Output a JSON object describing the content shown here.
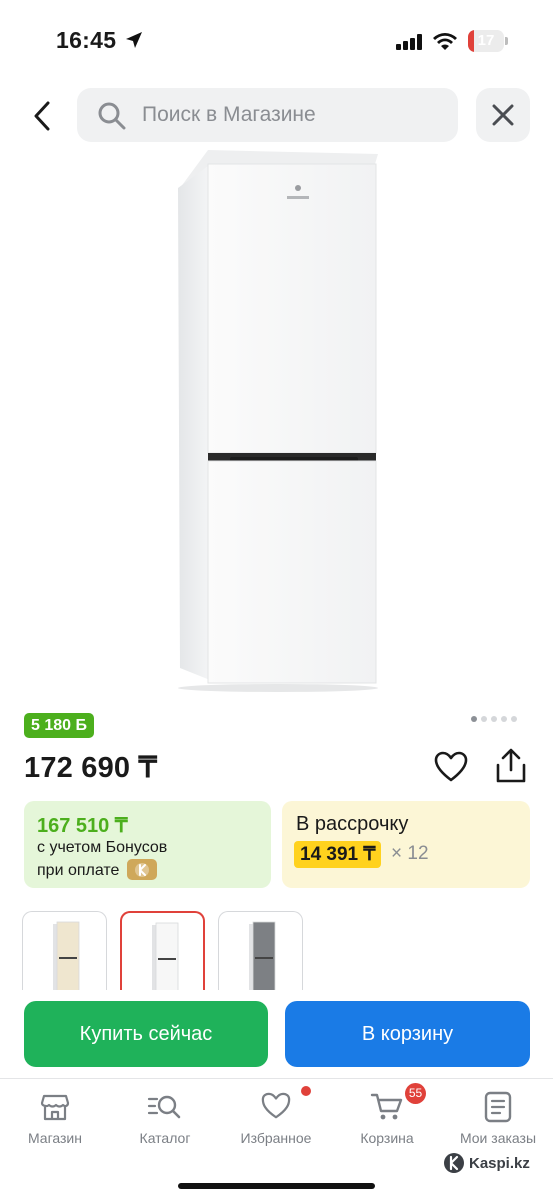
{
  "status_bar": {
    "time": "16:45",
    "battery": "17",
    "battery_fraction": 0.17,
    "icons": [
      "location-arrow-icon",
      "cellular-signal-icon",
      "wifi-icon",
      "battery-icon"
    ]
  },
  "top_nav": {
    "search_placeholder": "Поиск в Магазине",
    "icons": [
      "chevron-left-icon",
      "search-icon",
      "close-icon"
    ]
  },
  "product": {
    "bonus_badge": "5 180 Б",
    "image_count": 5,
    "active_image": 1,
    "price": "172 690 ₸"
  },
  "bonus_card": {
    "price": "167 510 ₸",
    "line1": "с учетом Бонусов",
    "line2": "при оплате",
    "color": "#4caf1d"
  },
  "installment": {
    "title": "В рассрочку",
    "price": "14 391 ₸",
    "months": "× 12"
  },
  "variants": [
    {
      "color_name": "beige",
      "color": "#efe6cf",
      "selected": false
    },
    {
      "color_name": "white",
      "color": "#f7f7f7",
      "selected": true
    },
    {
      "color_name": "silver",
      "color": "#7d8084",
      "selected": false
    }
  ],
  "actions": {
    "buy_now": "Купить сейчас",
    "add_to_cart": "В корзину",
    "buy_color": "#1fb25a",
    "cart_color": "#1a7be6"
  },
  "tab_bar": {
    "items": [
      {
        "label": "Магазин",
        "icon": "store-icon"
      },
      {
        "label": "Каталог",
        "icon": "catalog-search-icon"
      },
      {
        "label": "Избранное",
        "icon": "heart-icon"
      },
      {
        "label": "Корзина",
        "icon": "cart-icon"
      },
      {
        "label": "Мои заказы",
        "icon": "orders-icon"
      }
    ],
    "cart_count": "55"
  },
  "watermark": "Kaspi.kz"
}
